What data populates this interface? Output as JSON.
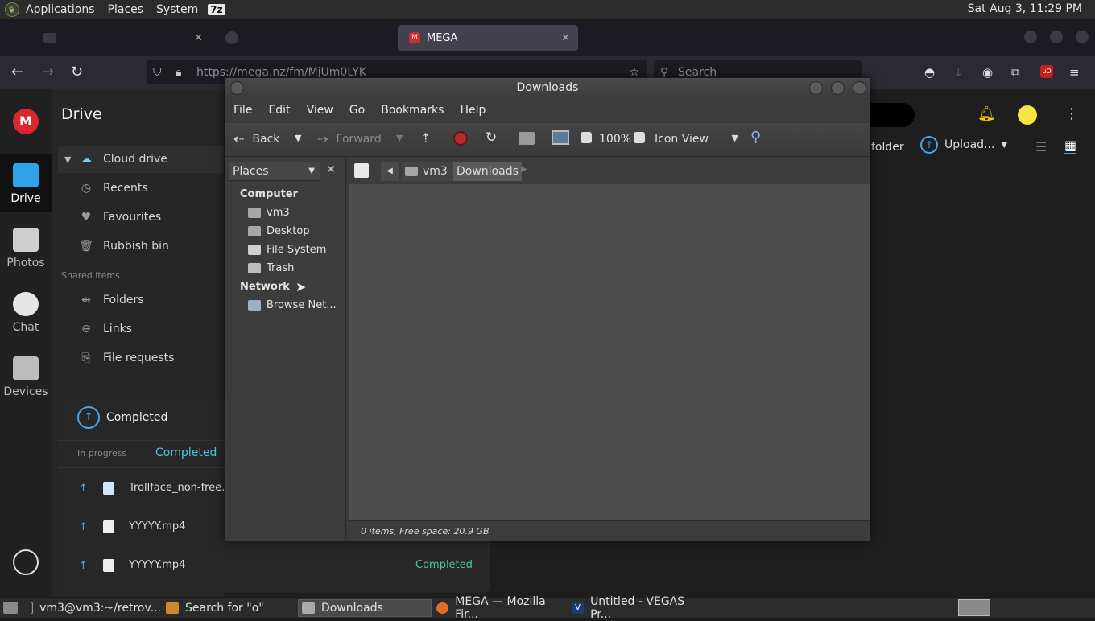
{
  "top_panel": {
    "menus": [
      "Applications",
      "Places",
      "System"
    ],
    "badge": "7z",
    "clock": "Sat Aug  3, 11:29 PM"
  },
  "firefox": {
    "tabs": [
      {
        "label": "",
        "active": false
      },
      {
        "label": "",
        "active": false
      },
      {
        "label": "MEGA",
        "active": true
      },
      {
        "label": "",
        "active": false
      }
    ],
    "close_glyph": "✕",
    "url": "https://mega.nz/fm/MjUm0LYK",
    "search_placeholder": "Search"
  },
  "mega": {
    "rail": [
      {
        "label": "Drive",
        "active": true
      },
      {
        "label": "Photos",
        "active": false
      },
      {
        "label": "Chat",
        "active": false
      },
      {
        "label": "Devices",
        "active": false
      }
    ],
    "logo": "M",
    "drive_title": "Drive",
    "sidebar": {
      "items": [
        {
          "label": "Cloud drive",
          "icon": "cloud-icon"
        },
        {
          "label": "Recents",
          "icon": "clock-icon"
        },
        {
          "label": "Favourites",
          "icon": "heart-icon"
        },
        {
          "label": "Rubbish bin",
          "icon": "trash-icon"
        }
      ],
      "shared_heading": "Shared items",
      "shared_items": [
        {
          "label": "Folders",
          "icon": "shared-folder-icon"
        },
        {
          "label": "Links",
          "icon": "link-icon"
        },
        {
          "label": "File requests",
          "icon": "file-request-icon"
        }
      ]
    },
    "header": {
      "new_folder_partial": "folder",
      "upload_label": "Upload...",
      "avatar_color": "#f5e642"
    },
    "transfers": {
      "title": "Completed",
      "tabs": [
        "In progress",
        "Completed"
      ],
      "rows": [
        {
          "name": "Trollface_non-free.p",
          "status": ""
        },
        {
          "name": "YYYYY.mp4",
          "status": ""
        },
        {
          "name": "YYYYY.mp4",
          "status": "Completed"
        }
      ]
    }
  },
  "nautilus": {
    "title": "Downloads",
    "menu": [
      "File",
      "Edit",
      "View",
      "Go",
      "Bookmarks",
      "Help"
    ],
    "toolbar": {
      "back": "Back",
      "forward": "Forward",
      "zoom": "100%",
      "view_mode": "Icon View"
    },
    "side_pane": {
      "selector": "Places",
      "computer_heading": "Computer",
      "computer_items": [
        "vm3",
        "Desktop",
        "File System",
        "Trash"
      ],
      "network_heading": "Network",
      "network_items": [
        "Browse Net..."
      ]
    },
    "path": [
      "vm3",
      "Downloads"
    ],
    "status": "0 items, Free space: 20.9 GB"
  },
  "taskbar": {
    "tasks": [
      {
        "label": "vm3@vm3:~/retrov...",
        "active": false
      },
      {
        "label": "Search for \"o\"",
        "active": false
      },
      {
        "label": "Downloads",
        "active": true
      },
      {
        "label": "MEGA — Mozilla Fir...",
        "active": false
      },
      {
        "label": "Untitled - VEGAS Pr...",
        "active": false
      }
    ]
  }
}
